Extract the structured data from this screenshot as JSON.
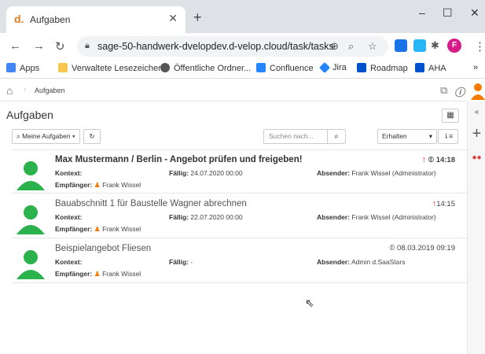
{
  "browser": {
    "tab_title": "Aufgaben",
    "tab_favicon": "d.",
    "url": "sage-50-handwerk-dvelopdev.d-velop.cloud/task/tasks",
    "bookmarks": [
      {
        "label": "Apps",
        "icon": "apps-grid-icon",
        "color": "#4285f4"
      },
      {
        "label": "Verwaltete Lesezeichen",
        "icon": "folder-icon",
        "color": "#f9c74f"
      },
      {
        "label": "Öffentliche Ordner...",
        "icon": "globe-icon",
        "color": "#555555"
      },
      {
        "label": "Confluence",
        "icon": "confluence-icon",
        "color": "#2684ff"
      },
      {
        "label": "Jira",
        "icon": "jira-icon",
        "color": "#2684ff"
      },
      {
        "label": "Roadmap",
        "icon": "roadmap-icon",
        "color": "#0052cc"
      },
      {
        "label": "AHA",
        "icon": "aha-icon",
        "color": "#0052cc"
      }
    ],
    "bookmarks_overflow": "»",
    "profile_initial": "F"
  },
  "app": {
    "breadcrumb": "Aufgaben",
    "page_title": "Aufgaben",
    "toolbar": {
      "filter_label": "Meine Aufgaben",
      "search_placeholder": "Suchen nach...",
      "sort_label": "Erhalten"
    },
    "labels": {
      "kontext": "Kontext:",
      "faellig": "Fällig:",
      "absender": "Absender:",
      "empfaenger": "Empfänger:"
    },
    "tasks": [
      {
        "title": "Max Mustermann / Berlin - Angebot prüfen und freigeben!",
        "kontext": "",
        "faellig": "24.07.2020 00:00",
        "absender": "Frank Wissel (Administrator)",
        "empfaenger": "Frank Wissel",
        "time": "14:18",
        "priority": true,
        "attachment": true,
        "unread": true
      },
      {
        "title": "Bauabschnitt 1 für Baustelle Wagner abrechnen",
        "kontext": "",
        "faellig": "22.07.2020 00:00",
        "absender": "Frank Wissel (Administrator)",
        "empfaenger": "Frank Wissel",
        "time": "14:15",
        "priority": true,
        "attachment": false,
        "unread": false
      },
      {
        "title": "Beispielangebot Fliesen",
        "kontext": "",
        "faellig": "-",
        "absender": "Admin d.SaaStars",
        "empfaenger": "Frank Wissel",
        "time": "08.03.2019 09:19",
        "priority": false,
        "attachment": true,
        "unread": false
      }
    ],
    "colors": {
      "avatar_green": "#2bb24c",
      "priority_red": "#e53935",
      "user_orange": "#f57c00"
    }
  }
}
